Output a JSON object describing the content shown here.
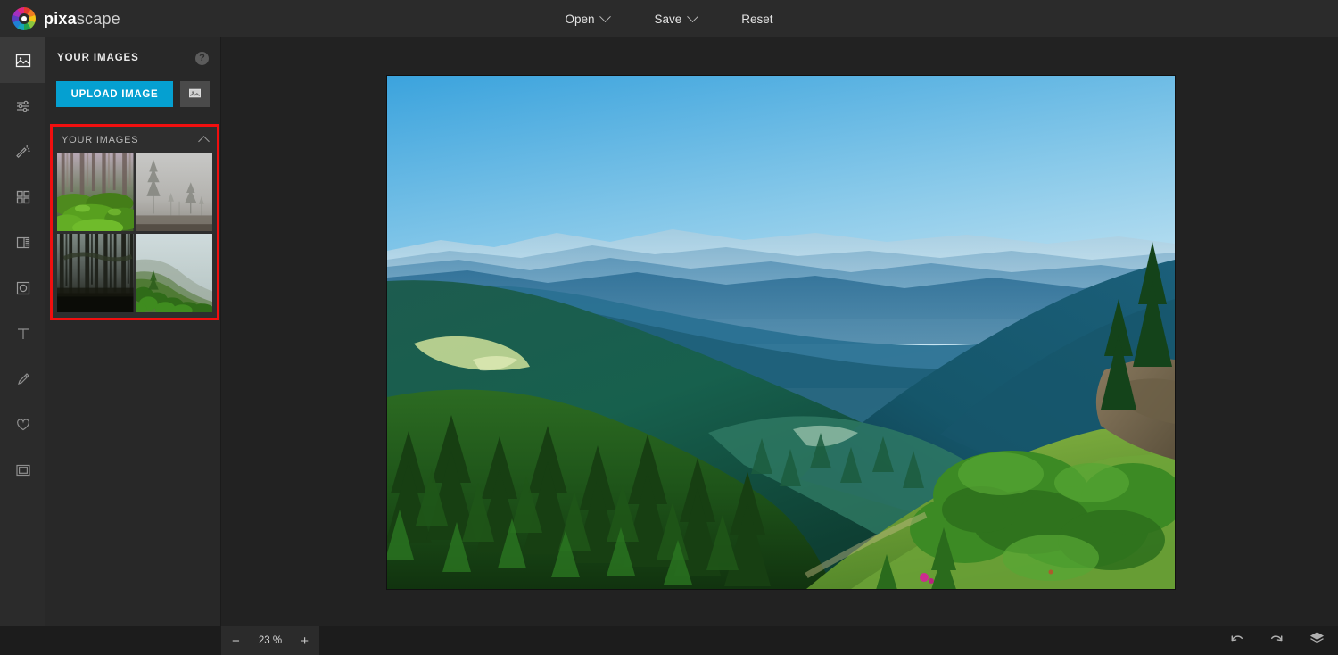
{
  "app": {
    "brand_bold": "pixa",
    "brand_light": "scape",
    "logo_icon": "pixascape-ring-logo"
  },
  "menu": {
    "items": [
      {
        "label": "Open",
        "icon": "chevron-down-icon",
        "has_caret": true
      },
      {
        "label": "Save",
        "icon": "chevron-down-icon",
        "has_caret": true
      },
      {
        "label": "Reset",
        "has_caret": false
      }
    ]
  },
  "rail": {
    "items": [
      {
        "name": "image-tool",
        "icon": "image-icon",
        "active": true
      },
      {
        "name": "adjust-tool",
        "icon": "sliders-icon",
        "active": false
      },
      {
        "name": "effects-tool",
        "icon": "magic-wand-icon",
        "active": false
      },
      {
        "name": "filters-tool",
        "icon": "grid-four-squares-icon",
        "active": false
      },
      {
        "name": "frames-tool",
        "icon": "filmstrip-icon",
        "active": false
      },
      {
        "name": "shapes-tool",
        "icon": "circle-in-square-icon",
        "active": false
      },
      {
        "name": "text-tool",
        "icon": "text-t-icon",
        "active": false
      },
      {
        "name": "draw-tool",
        "icon": "pen-icon",
        "active": false
      },
      {
        "name": "stickers-tool",
        "icon": "heart-icon",
        "active": false
      },
      {
        "name": "border-tool",
        "icon": "frame-border-icon",
        "active": false
      }
    ],
    "settings": {
      "name": "settings",
      "icon": "gear-icon"
    }
  },
  "panel": {
    "title": "YOUR IMAGES",
    "help_icon": "question-mark-icon",
    "help_glyph": "?",
    "upload_label": "UPLOAD IMAGE",
    "upload_color": "#05a0d1",
    "picker_icon": "picture-icon",
    "section": {
      "title": "YOUR IMAGES",
      "collapse_icon": "chevron-up-icon",
      "highlight_color": "#f10f0f",
      "thumbnails": [
        {
          "name": "thumbnail-mossy-forest",
          "alt": "Mossy green forest floor with tall trunks"
        },
        {
          "name": "thumbnail-foggy-pines",
          "alt": "Pale grey fog with sparse pine silhouettes"
        },
        {
          "name": "thumbnail-dark-misty-forest",
          "alt": "Dark misty forest of thin trunks"
        },
        {
          "name": "thumbnail-green-hillside",
          "alt": "Green shrubs on a foggy hillside"
        }
      ]
    }
  },
  "canvas": {
    "image_name": "mountain-valley-landscape",
    "image_alt": "Aerial view of a pine forest valley with layered hazy blue mountain ridges"
  },
  "bottombar": {
    "zoom_out_glyph": "−",
    "zoom_value": "23 %",
    "zoom_in_glyph": "+",
    "actions": [
      {
        "name": "undo-button",
        "icon": "undo-arrow-icon"
      },
      {
        "name": "redo-button",
        "icon": "redo-arrow-icon"
      },
      {
        "name": "layers-button",
        "icon": "layers-icon"
      }
    ]
  }
}
